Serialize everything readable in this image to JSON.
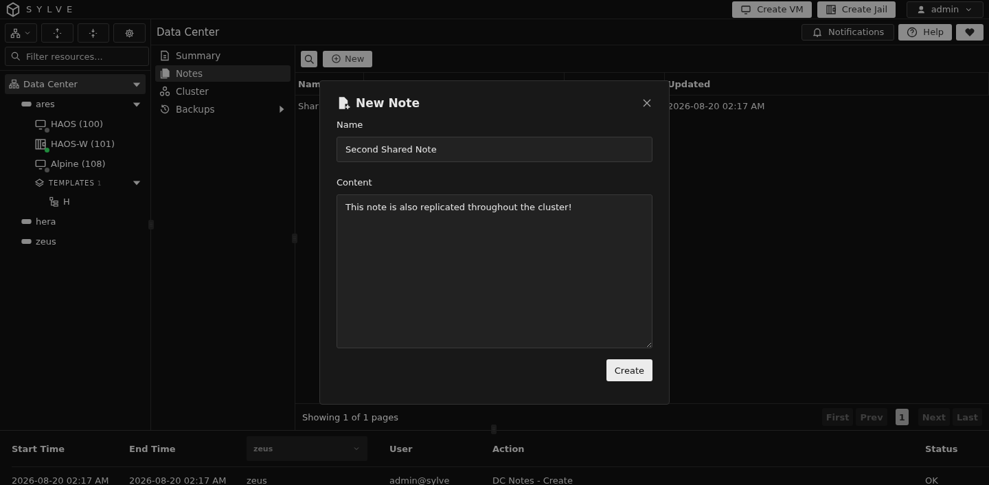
{
  "brand": "SYLVE",
  "top_buttons": [
    {
      "kind": "vm",
      "label": "Create VM"
    },
    {
      "kind": "jail",
      "label": "Create Jail"
    }
  ],
  "user_menu": {
    "label": "admin"
  },
  "filter": {
    "placeholder": "Filter resources..."
  },
  "tree": [
    {
      "kind": "datacenter",
      "label": "Data Center",
      "selected": true,
      "expanded": true,
      "children": [
        {
          "kind": "node",
          "label": "ares",
          "expanded": true,
          "children": [
            {
              "kind": "vm",
              "label": "HAOS (100)",
              "color": "#4a4a4a"
            },
            {
              "kind": "jail",
              "label": "HAOS-W (101)",
              "color": "#1f8a3c"
            },
            {
              "kind": "vm",
              "label": "Alpine (108)",
              "color": "#4a4a4a"
            },
            {
              "kind": "templates",
              "label": "TEMPLATES",
              "count": "1",
              "expanded": true,
              "children": [
                {
                  "kind": "template",
                  "label": "H"
                }
              ]
            }
          ]
        },
        {
          "kind": "node",
          "label": "hera"
        },
        {
          "kind": "node",
          "label": "zeus"
        }
      ]
    }
  ],
  "header": {
    "title": "Data Center",
    "buttons": [
      {
        "kind": "notifications",
        "label": "Notifications"
      },
      {
        "kind": "help",
        "label": "Help"
      },
      {
        "kind": "heart"
      }
    ]
  },
  "nav": [
    {
      "kind": "summary",
      "label": "Summary",
      "selected": false
    },
    {
      "kind": "notes",
      "label": "Notes",
      "selected": true
    },
    {
      "kind": "cluster",
      "label": "Cluster",
      "selected": false
    },
    {
      "kind": "backups",
      "label": "Backups",
      "selected": false,
      "submenu": true
    }
  ],
  "toolbar": {
    "new_label": "New"
  },
  "table": {
    "columns": [
      "Nam",
      "",
      "",
      "Updated"
    ],
    "rows": [
      [
        "Shar",
        "",
        "",
        "2026-08-20 02:17 AM"
      ]
    ]
  },
  "footer": {
    "info": "Showing 1 of 1 pages",
    "pages": [
      {
        "label": "First",
        "disabled": true,
        "selected": false
      },
      {
        "label": "Prev",
        "disabled": true,
        "selected": false
      },
      {
        "label": "1",
        "disabled": false,
        "selected": true
      },
      {
        "label": "Next",
        "disabled": true,
        "selected": false
      },
      {
        "label": "Last",
        "disabled": true,
        "selected": false
      }
    ]
  },
  "dialog": {
    "title": "New Note",
    "name_label": "Name",
    "name_value": "Second Shared Note",
    "content_label": "Content",
    "content_value": "This note is also replicated throughout the cluster!",
    "submit": "Create"
  },
  "log": {
    "columns": [
      {
        "kind": "text",
        "label": "Start Time"
      },
      {
        "kind": "text",
        "label": "End Time"
      },
      {
        "kind": "select",
        "label": "zeus"
      },
      {
        "kind": "text",
        "label": "User"
      },
      {
        "kind": "text",
        "label": "Action"
      },
      {
        "kind": "text",
        "label": "Status"
      }
    ],
    "rows": [
      [
        "2026-08-20 02:17 AM",
        "2026-08-20 02:17 AM",
        "zeus",
        "admin@sylve",
        "DC Notes - Create",
        "OK"
      ]
    ]
  }
}
